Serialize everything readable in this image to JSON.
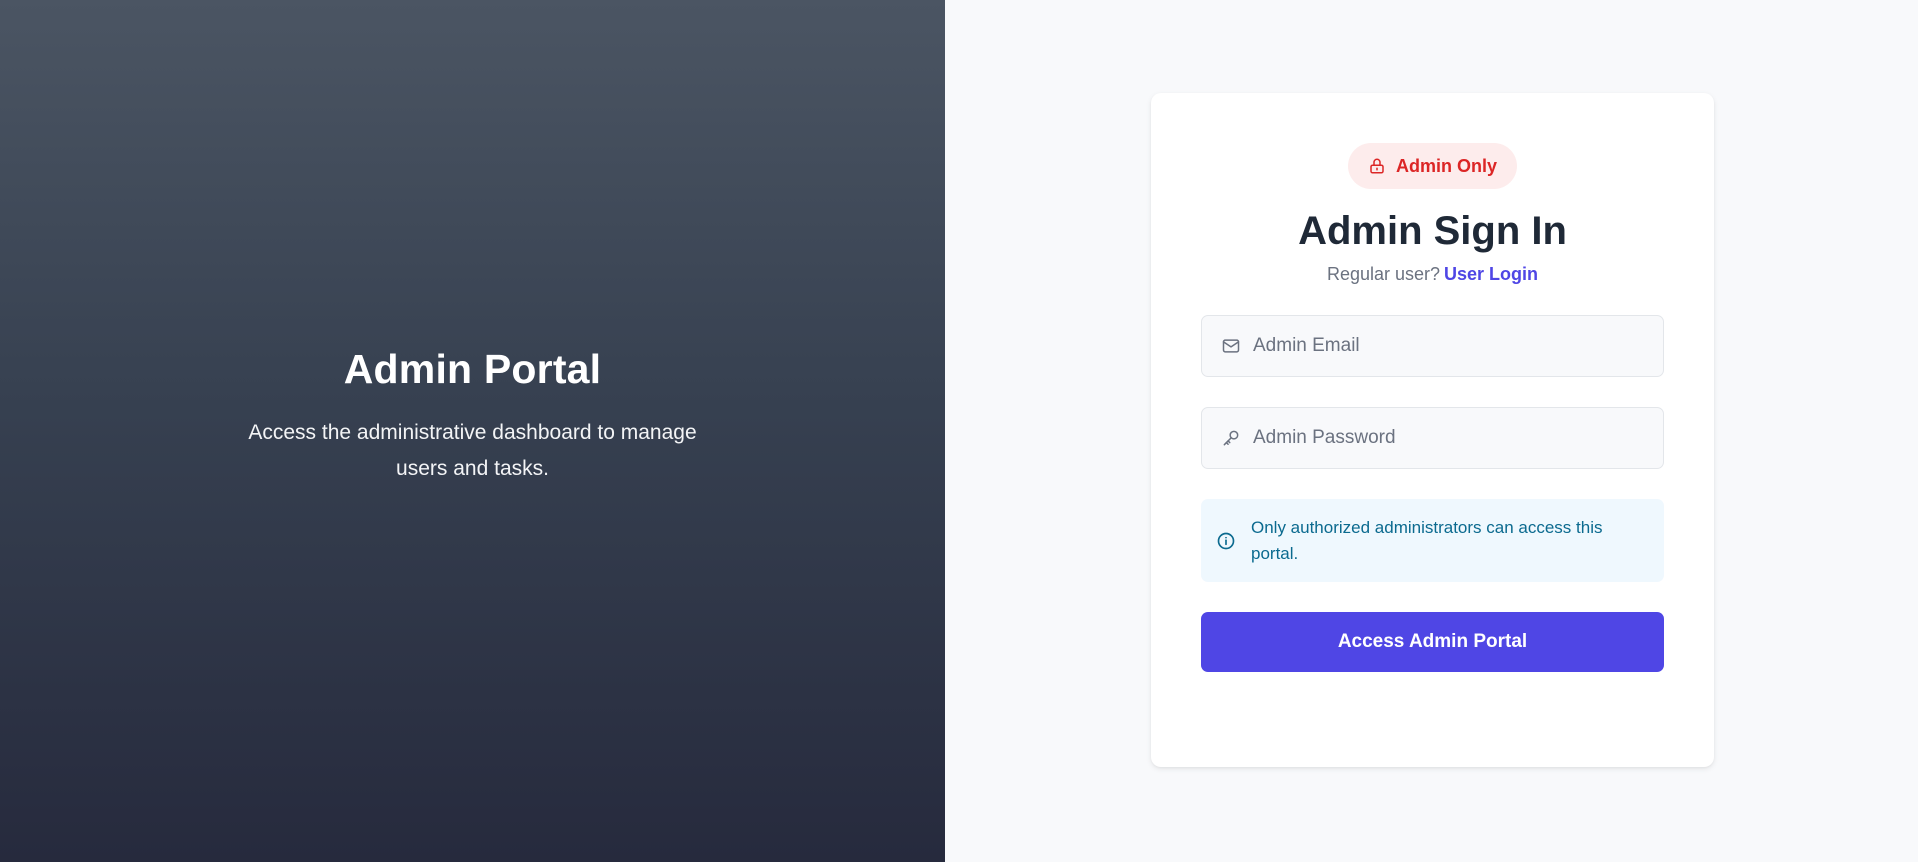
{
  "hero": {
    "title": "Admin Portal",
    "description": "Access the administrative dashboard to manage users and tasks."
  },
  "login": {
    "badge": {
      "label": "Admin Only",
      "icon": "lock-icon"
    },
    "title": "Admin Sign In",
    "subtitle": {
      "prefix": "Regular user?",
      "link_label": "User Login"
    },
    "email": {
      "placeholder": "Admin Email",
      "value": "",
      "icon": "mail-icon"
    },
    "password": {
      "placeholder": "Admin Password",
      "value": "",
      "icon": "key-icon"
    },
    "notice": {
      "text": "Only authorized administrators can access this portal.",
      "icon": "info-icon"
    },
    "submit_label": "Access Admin Portal"
  },
  "colors": {
    "accent": "#4f46e5",
    "badge_text": "#dc2626",
    "badge_bg": "#fdecec",
    "notice_text": "#0b6a8f",
    "notice_bg": "#eff8fe"
  }
}
